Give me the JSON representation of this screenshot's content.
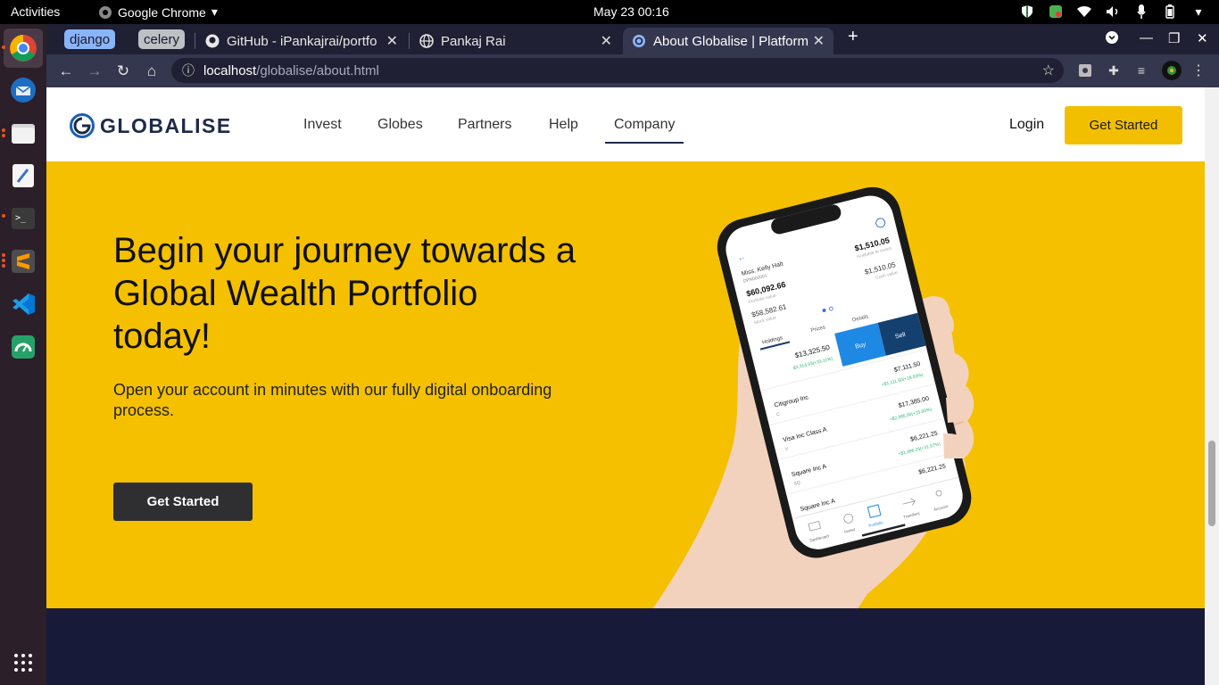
{
  "system": {
    "activities": "Activities",
    "app_name": "Google Chrome",
    "clock": "May 23  00:16"
  },
  "browser": {
    "tab_groups": [
      {
        "label": "django",
        "color": "#8ab4f8"
      },
      {
        "label": "celery",
        "color": "#bdc1c6"
      }
    ],
    "tabs": [
      {
        "title": "GitHub - iPankajrai/portfo"
      },
      {
        "title": "Pankaj Rai"
      },
      {
        "title": "About Globalise | Platform"
      }
    ],
    "url_host": "localhost",
    "url_path": "/globalise/about.html"
  },
  "site": {
    "logo_text": "GLOBALISE",
    "nav": [
      "Invest",
      "Globes",
      "Partners",
      "Help",
      "Company"
    ],
    "active_nav": "Company",
    "login": "Login",
    "cta_top": "Get Started",
    "accent": "#f4c000",
    "dark": "#181a3a"
  },
  "hero": {
    "heading": "Begin your journey towards a Global Wealth Portfolio today!",
    "subtext": "Open your account in minutes with our fully digital onboarding process.",
    "cta": "Get Started"
  },
  "phone": {
    "user_name": "Miss. Kelly Halt",
    "account_id": "DPN000001",
    "portfolio_value": "$60,092.66",
    "portfolio_label": "Portfolio value",
    "stock_value": "$58,582.61",
    "stock_label": "Stock value",
    "available": "$1,510.05",
    "available_label": "Available to invest",
    "cash": "$1,510.05",
    "cash_label": "Cash value",
    "tabs": [
      "Holdings",
      "Prices",
      "Details"
    ],
    "buy": "Buy",
    "sell": "Sell",
    "summary_value": "$13,325.50",
    "summary_change": "$3,314.93(+33.11%)",
    "holdings": [
      {
        "name": "Citigroup Inc",
        "ticker": "C",
        "value": "$7,111.50",
        "change": "+$1,111.50(+18.53%)"
      },
      {
        "name": "Visa Inc Class A",
        "ticker": "V",
        "value": "$17,385.00",
        "change": "+$2,385.00(+15.90%)"
      },
      {
        "name": "Square Inc A",
        "ticker": "SQ",
        "value": "$6,221.25",
        "change": "+$1,496.25(+31.67%)"
      },
      {
        "name": "Square Inc A",
        "ticker": "",
        "value": "$6,221.25",
        "change": ""
      }
    ],
    "bottom_nav": [
      "Dashboard",
      "Invest",
      "Portfolio",
      "Transfers",
      "Account"
    ]
  }
}
